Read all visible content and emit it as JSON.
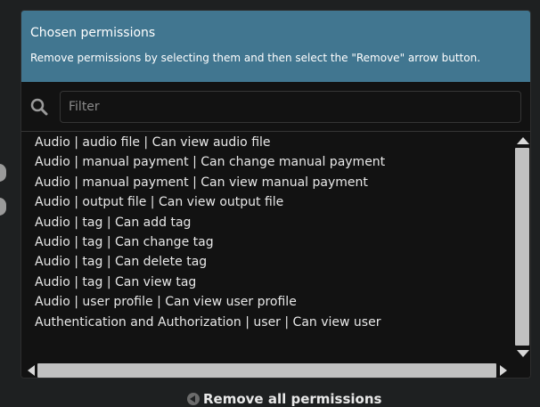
{
  "panel": {
    "title": "Chosen permissions",
    "help": "Remove permissions by selecting them and then select the \"Remove\" arrow button.",
    "header_color": "#417690"
  },
  "filter": {
    "placeholder": "Filter",
    "value": ""
  },
  "permissions": [
    "Audio | audio file | Can view audio file",
    "Audio | manual payment | Can change manual payment",
    "Audio | manual payment | Can view manual payment",
    "Audio | output file | Can view output file",
    "Audio | tag | Can add tag",
    "Audio | tag | Can change tag",
    "Audio | tag | Can delete tag",
    "Audio | tag | Can view tag",
    "Audio | user profile | Can view user profile",
    "Authentication and Authorization | user | Can view user"
  ],
  "actions": {
    "remove_all": "Remove all permissions"
  },
  "icons": {
    "search": "search-icon",
    "remove_all": "remove-all-icon"
  }
}
